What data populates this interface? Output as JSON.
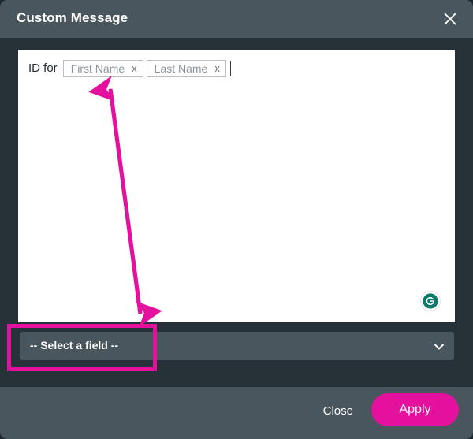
{
  "dialog": {
    "title": "Custom Message",
    "close_icon": "close-icon"
  },
  "editor": {
    "text_prefix": "ID for",
    "tags": [
      {
        "label": "First Name",
        "remove": "x"
      },
      {
        "label": "Last Name",
        "remove": "x"
      }
    ],
    "grammarly_icon": "grammarly-g-icon"
  },
  "field_select": {
    "value": "-- Select a field --",
    "chevron_icon": "chevron-down-icon"
  },
  "footer": {
    "close_label": "Close",
    "apply_label": "Apply"
  },
  "colors": {
    "accent_magenta": "#e3119e",
    "header_slate": "#4a565d",
    "body_dark": "#263238",
    "grammarly_green": "#0b7a69"
  }
}
